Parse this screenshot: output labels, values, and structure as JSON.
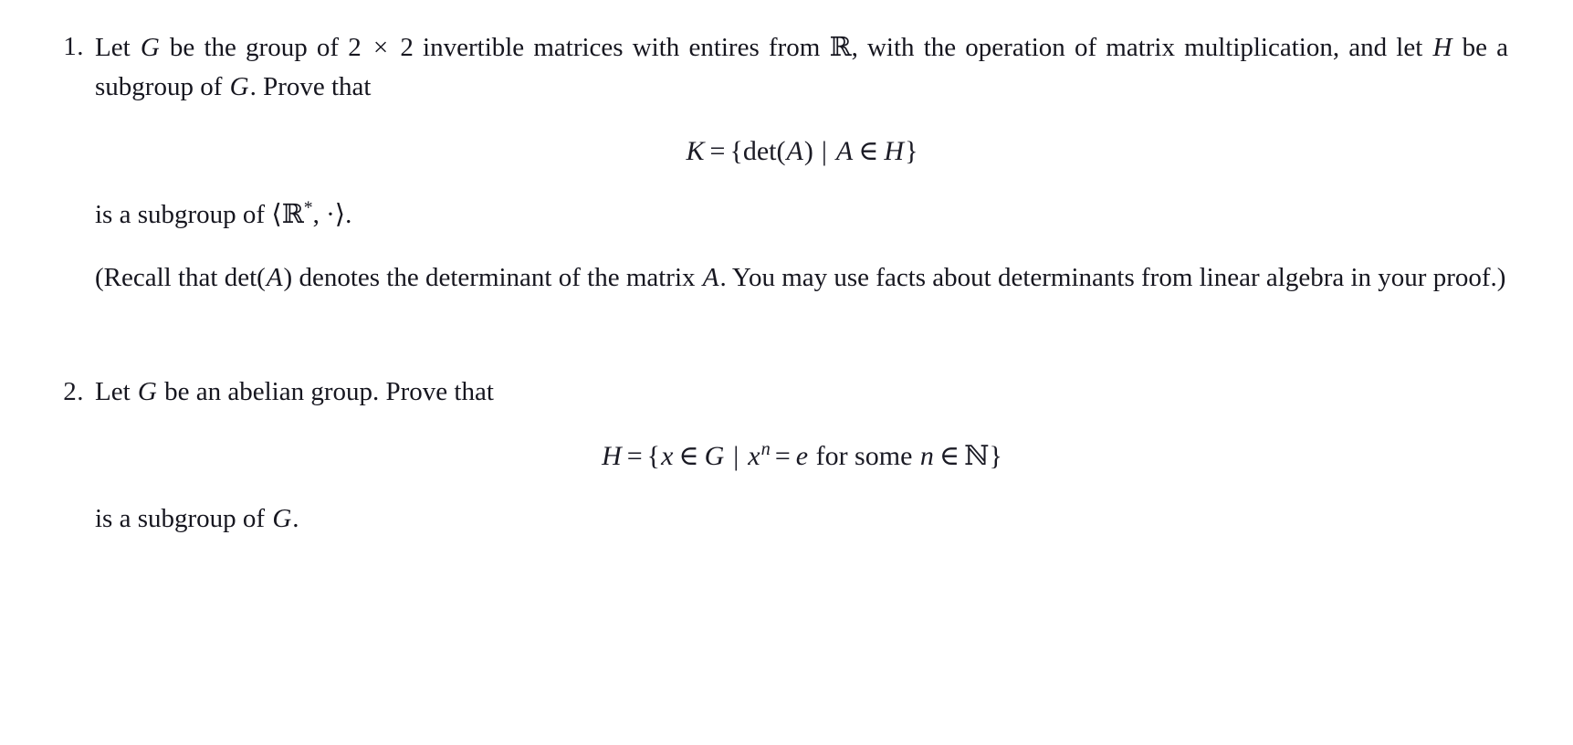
{
  "document": {
    "kind": "math-homework-problems",
    "background_color": "#ffffff",
    "text_color": "#16161f"
  },
  "problems": [
    {
      "number": "1.",
      "paragraphs": [
        {
          "id": "p1-intro",
          "runs": [
            {
              "t": "text",
              "v": "Let "
            },
            {
              "t": "var",
              "v": "G"
            },
            {
              "t": "text",
              "v": " be the group of 2 "
            },
            {
              "t": "op",
              "v": "×"
            },
            {
              "t": "text",
              "v": " 2 invertible matrices with entires from "
            },
            {
              "t": "bb",
              "v": "ℝ"
            },
            {
              "t": "text",
              "v": ", with the operation of matrix multiplication, and let "
            },
            {
              "t": "var",
              "v": "H"
            },
            {
              "t": "text",
              "v": " be a subgroup of "
            },
            {
              "t": "var",
              "v": "G"
            },
            {
              "t": "text",
              "v": ". Prove that"
            }
          ],
          "plain": "Let G be the group of 2 × 2 invertible matrices with entires from ℝ, with the operation of matrix multiplication, and let H be a subgroup of G. Prove that"
        }
      ],
      "equation": {
        "id": "eq-K",
        "latex": "K = \\{\\det(A) \\mid A \\in H\\}",
        "plain": "K = {det(A) | A ∈ H}",
        "parts": {
          "lhs": "K",
          "equals": "=",
          "open_brace": "{",
          "det": "det",
          "open_paren": "(",
          "arg": "A",
          "close_paren": ")",
          "such_that": "|",
          "elem": "A",
          "in": "∈",
          "set": "H",
          "close_brace": "}"
        }
      },
      "after_equation": {
        "id": "p1-conclusion",
        "plain": "is a subgroup of ⟨ℝ*, ·⟩.",
        "parts": {
          "lead": "is a subgroup of ",
          "open_angle": "⟨",
          "reals": "ℝ",
          "star": "*",
          "comma": ", ",
          "dot": "·",
          "close_angle": "⟩",
          "period": "."
        }
      },
      "note": {
        "id": "p1-note",
        "plain": "(Recall that det(A) denotes the determinant of the matrix A. You may use facts about determinants from linear algebra in your proof.)",
        "parts": {
          "lead": "(Recall that ",
          "det": "det",
          "open_paren": "(",
          "arg": "A",
          "close_paren": ")",
          "mid": " denotes the determinant of the matrix ",
          "matrix": "A",
          "tail": ". You may use facts about determinants from linear algebra in your proof.)"
        }
      }
    },
    {
      "number": "2.",
      "paragraphs": [
        {
          "id": "p2-intro",
          "plain": "Let G be an abelian group. Prove that",
          "parts": {
            "lead": "Let ",
            "group": "G",
            "tail": " be an abelian group. Prove that"
          }
        }
      ],
      "equation": {
        "id": "eq-H",
        "latex": "H = \\{x \\in G \\mid x^{n} = e \\text{ for some } n \\in \\mathbb{N}\\}",
        "plain": "H = {x ∈ G | x^n = e for some n ∈ ℕ}",
        "parts": {
          "lhs": "H",
          "equals": "=",
          "open_brace": "{",
          "elem": "x",
          "in": "∈",
          "group": "G",
          "such_that": "|",
          "base": "x",
          "exponent": "n",
          "equals2": "=",
          "identity": "e",
          "words": "for some",
          "index": "n",
          "in2": "∈",
          "naturals": "ℕ",
          "close_brace": "}"
        }
      },
      "after_equation": {
        "id": "p2-conclusion",
        "plain": "is a subgroup of G.",
        "parts": {
          "lead": "is a subgroup of ",
          "group": "G",
          "period": "."
        }
      }
    }
  ]
}
